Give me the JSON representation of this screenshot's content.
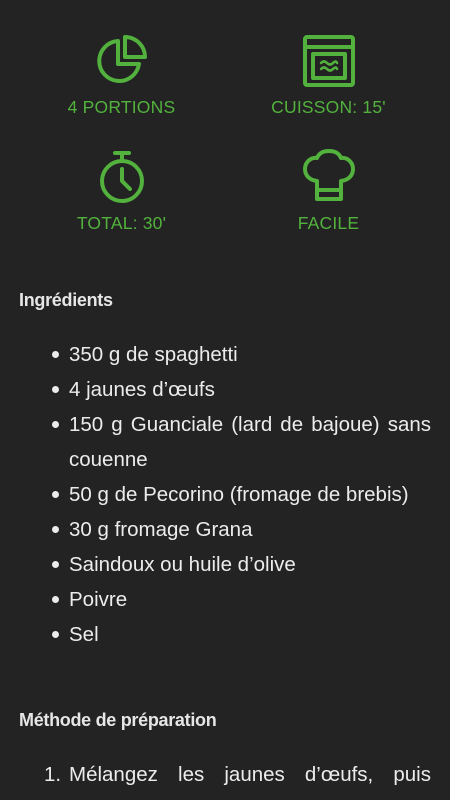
{
  "theme": {
    "background": "#232323",
    "accent": "#52b23d",
    "text": "#ececec"
  },
  "stats": [
    {
      "icon": "pie-chart-icon",
      "label": "4 PORTIONS"
    },
    {
      "icon": "oven-icon",
      "label": "CUISSON: 15'"
    },
    {
      "icon": "stopwatch-icon",
      "label": "TOTAL: 30'"
    },
    {
      "icon": "chef-hat-icon",
      "label": "FACILE"
    }
  ],
  "ingredients": {
    "title": "Ingrédients",
    "items": [
      "350 g de spaghetti",
      "4 jaunes d’œufs",
      "150 g Guanciale (lard de bajoue) sans couenne",
      "50 g de Pecorino (fromage de brebis)",
      "30 g fromage Grana",
      "Saindoux ou huile d’olive",
      "Poivre",
      "Sel"
    ]
  },
  "method": {
    "title": "Méthode de préparation",
    "steps": [
      {
        "number": "1.",
        "text": "Mélangez les jaunes d’œufs, puis"
      }
    ]
  }
}
